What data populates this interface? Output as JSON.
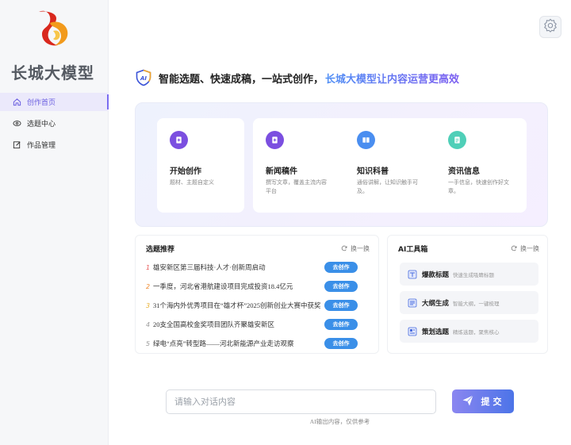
{
  "sidebar": {
    "brand": "长城大模型",
    "items": [
      {
        "label": "创作首页",
        "icon": "home-icon",
        "active": true
      },
      {
        "label": "选题中心",
        "icon": "eye-icon",
        "active": false
      },
      {
        "label": "作品管理",
        "icon": "edit-icon",
        "active": false
      }
    ]
  },
  "header": {
    "tagline_main": "智能选题、快速成稿，一站式创作，",
    "tagline_accent": "长城大模型让内容运营更高效"
  },
  "features": [
    {
      "title": "开始创作",
      "desc": "题材、主题自定义",
      "color": "#7b4fe0",
      "icon": "plus-doc-icon"
    },
    {
      "title": "新闻稿件",
      "desc": "撰写文章，覆盖主流内容平台",
      "color": "#7b4fe0",
      "icon": "plus-doc-icon"
    },
    {
      "title": "知识科普",
      "desc": "通俗讲解，让知识触手可及。",
      "color": "#4a8ef0",
      "icon": "book-icon"
    },
    {
      "title": "资讯信息",
      "desc": "一手信息，快速创作好文章。",
      "color": "#4fcfb8",
      "icon": "note-icon"
    }
  ],
  "topics": {
    "title": "选题推荐",
    "refresh_label": "换一换",
    "go_label": "去创作",
    "items": [
      {
        "num": "1",
        "text": "雄安新区第三届科技·人才·创新周启动",
        "color": "#e85a5a"
      },
      {
        "num": "2",
        "text": "一季度，河北省港航建设项目完成投资18.4亿元",
        "color": "#f08a30"
      },
      {
        "num": "3",
        "text": "31个海内外优秀项目在“雄才杯”2025创新创业大赛中获奖",
        "color": "#e8b030"
      },
      {
        "num": "4",
        "text": "20支全国高校金奖项目团队齐聚雄安新区",
        "color": "#999999"
      },
      {
        "num": "5",
        "text": "绿电“点亮”转型路——河北新能源产业走访观察",
        "color": "#999999"
      }
    ]
  },
  "toolbox": {
    "title": "AI工具箱",
    "refresh_label": "换一换",
    "items": [
      {
        "name": "爆款标题",
        "desc": "快速生成吸睛标题",
        "icon": "title-icon"
      },
      {
        "name": "大纲生成",
        "desc": "智能大纲，一键梳理",
        "icon": "outline-icon"
      },
      {
        "name": "策划选题",
        "desc": "精炼选题，聚焦核心",
        "icon": "plan-icon"
      }
    ]
  },
  "chat": {
    "placeholder": "请输入对话内容",
    "submit_label": "提交",
    "disclaimer": "AI输出内容，仅供参考"
  },
  "colors": {
    "accent": "#7a6cf0",
    "button_blue": "#3a8fe8"
  }
}
